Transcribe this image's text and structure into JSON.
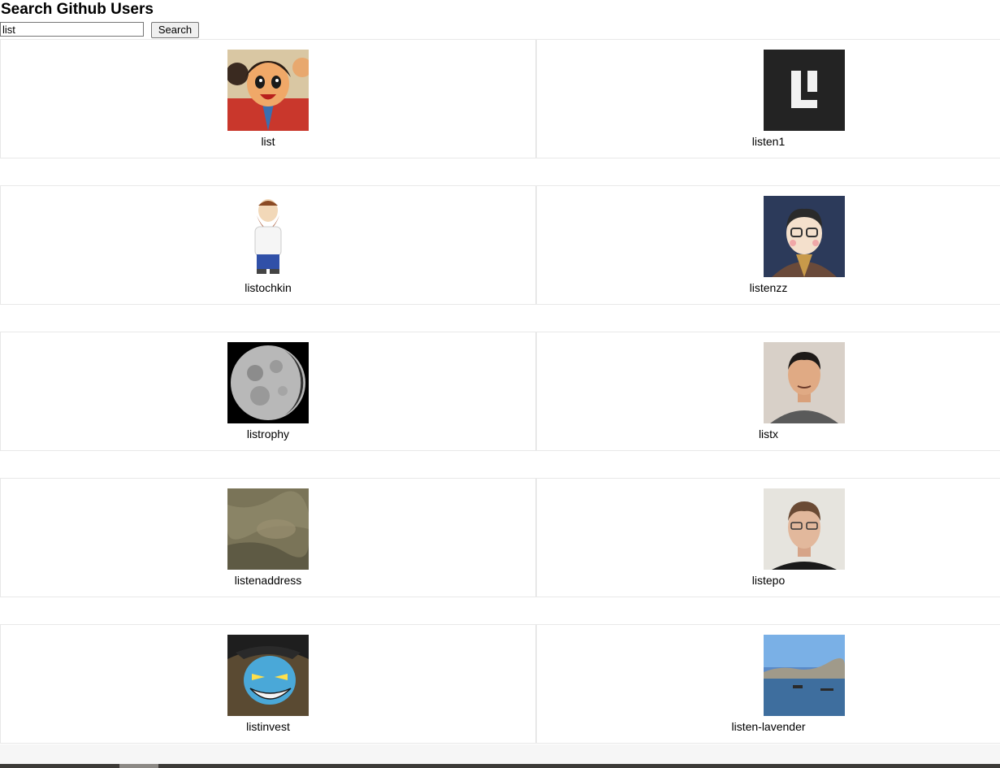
{
  "header": {
    "title": "Search Github Users"
  },
  "search": {
    "value": "list",
    "button_label": "Search"
  },
  "users": [
    {
      "login": "list"
    },
    {
      "login": "listen1"
    },
    {
      "login": "listochkin"
    },
    {
      "login": "listenzz"
    },
    {
      "login": "listrophy"
    },
    {
      "login": "listx"
    },
    {
      "login": "listenaddress"
    },
    {
      "login": "listepo"
    },
    {
      "login": "listinvest"
    },
    {
      "login": "listen-lavender"
    }
  ]
}
